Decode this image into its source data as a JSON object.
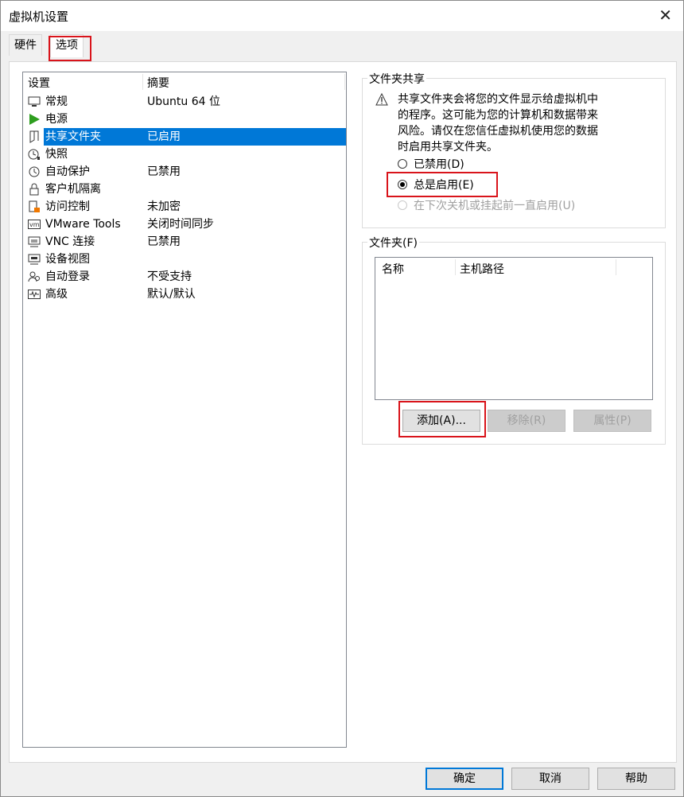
{
  "window": {
    "title": "虚拟机设置",
    "close_glyph": "✕"
  },
  "tabs": [
    {
      "label": "硬件"
    },
    {
      "label": "选项"
    }
  ],
  "settings": {
    "header": {
      "col1": "设置",
      "col2": "摘要"
    },
    "items": [
      {
        "name": "常规",
        "summary": "Ubuntu 64 位",
        "icon": "monitor-icon"
      },
      {
        "name": "电源",
        "summary": "",
        "icon": "play-icon"
      },
      {
        "name": "共享文件夹",
        "summary": "已启用",
        "icon": "shared-folder-icon"
      },
      {
        "name": "快照",
        "summary": "",
        "icon": "snapshot-icon"
      },
      {
        "name": "自动保护",
        "summary": "已禁用",
        "icon": "clock-icon"
      },
      {
        "name": "客户机隔离",
        "summary": "",
        "icon": "lock-icon"
      },
      {
        "name": "访问控制",
        "summary": "未加密",
        "icon": "access-icon"
      },
      {
        "name": "VMware Tools",
        "summary": "关闭时间同步",
        "icon": "vm-icon"
      },
      {
        "name": "VNC 连接",
        "summary": "已禁用",
        "icon": "vnc-icon"
      },
      {
        "name": "设备视图",
        "summary": "",
        "icon": "device-view-icon"
      },
      {
        "name": "自动登录",
        "summary": "不受支持",
        "icon": "users-icon"
      },
      {
        "name": "高级",
        "summary": "默认/默认",
        "icon": "wave-icon"
      }
    ]
  },
  "sharing": {
    "title": "文件夹共享",
    "warning": [
      "共享文件夹会将您的文件显示给虚拟机中",
      "的程序。这可能为您的计算机和数据带来",
      "风险。请仅在您信任虚拟机使用您的数据",
      "时启用共享文件夹。"
    ],
    "options": [
      {
        "label": "已禁用(D)",
        "checked": false,
        "disabled": false
      },
      {
        "label": "总是启用(E)",
        "checked": true,
        "disabled": false
      },
      {
        "label": "在下次关机或挂起前一直启用(U)",
        "checked": false,
        "disabled": true
      }
    ]
  },
  "folders": {
    "title": "文件夹(F)",
    "columns": [
      "名称",
      "主机路径"
    ],
    "buttons": {
      "add": "添加(A)...",
      "remove": "移除(R)",
      "properties": "属性(P)"
    }
  },
  "footer": {
    "ok": "确定",
    "cancel": "取消",
    "help": "帮助"
  },
  "colors": {
    "highlight": "#d9141b",
    "selection": "#0078d7"
  }
}
